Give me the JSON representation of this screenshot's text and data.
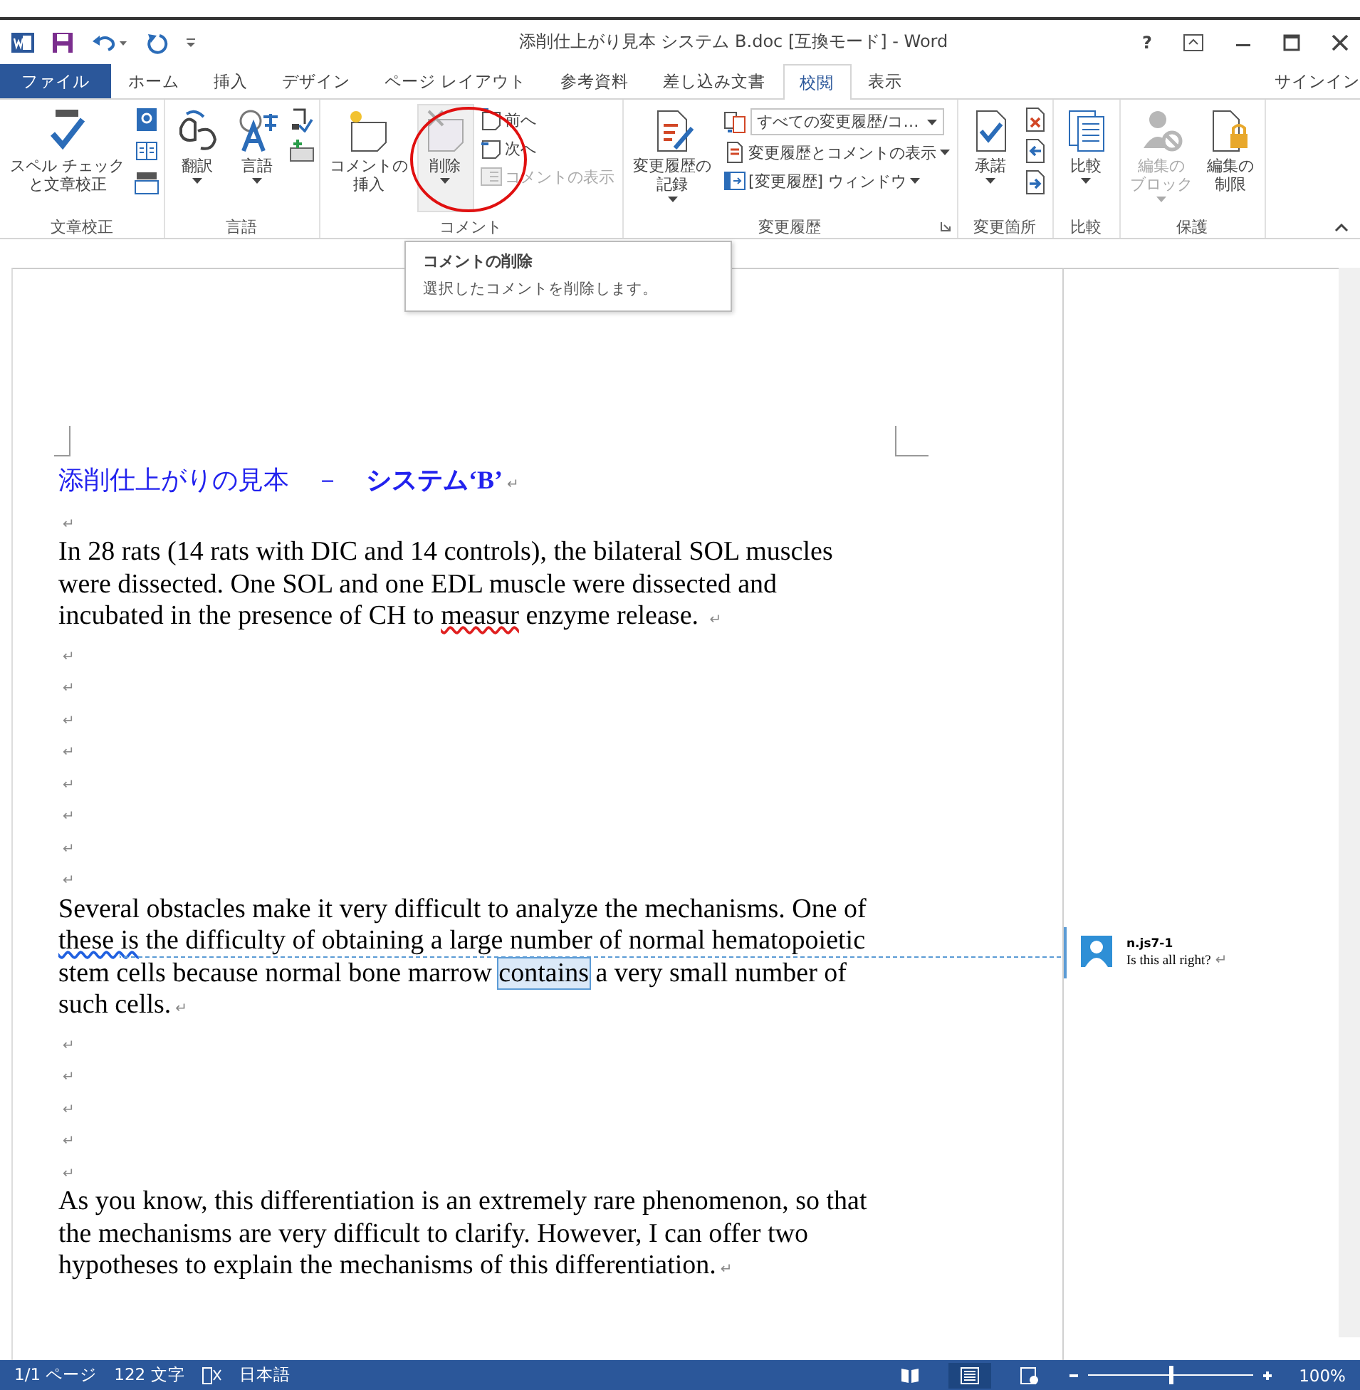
{
  "window": {
    "title": "添削仕上がり見本 システム B.doc [互換モード] - Word",
    "controls": [
      "?"
    ]
  },
  "tabs": [
    {
      "label": "ファイル",
      "kind": "file",
      "selected": false
    },
    {
      "label": "ホーム",
      "kind": "tab",
      "selected": false
    },
    {
      "label": "挿入",
      "kind": "tab",
      "selected": false
    },
    {
      "label": "デザイン",
      "kind": "tab",
      "selected": false
    },
    {
      "label": "ページ レイアウト",
      "kind": "tab",
      "selected": false
    },
    {
      "label": "参考資料",
      "kind": "tab",
      "selected": false
    },
    {
      "label": "差し込み文書",
      "kind": "tab",
      "selected": false
    },
    {
      "label": "校閲",
      "kind": "tab",
      "selected": true
    },
    {
      "label": "表示",
      "kind": "tab",
      "selected": false
    }
  ],
  "sign_in": "サインイン",
  "ribbon": [
    {
      "label": "文章校正",
      "items": [
        {
          "kind": "large",
          "label": "スペル チェックと文章校正",
          "dropdown": false,
          "disabled": false
        },
        {
          "kind": "icons"
        }
      ]
    },
    {
      "label": "言語",
      "items": [
        {
          "kind": "large",
          "label": "翻訳",
          "dropdown": true,
          "disabled": false
        },
        {
          "kind": "large",
          "label": "言語",
          "dropdown": true,
          "disabled": false
        },
        {
          "kind": "icons"
        }
      ]
    },
    {
      "label": "コメント",
      "items": [
        {
          "kind": "large",
          "label": "コメントの挿入",
          "dropdown": false,
          "disabled": false
        },
        {
          "kind": "large",
          "label": "削除",
          "dropdown": true,
          "disabled": false,
          "hovered": true
        },
        {
          "kind": "small",
          "entries": [
            {
              "label": "前へ",
              "dropdown": false,
              "disabled": false
            },
            {
              "label": "次へ",
              "dropdown": false,
              "disabled": false
            },
            {
              "label": "コメントの表示",
              "dropdown": false,
              "disabled": true
            }
          ]
        }
      ]
    },
    {
      "label": "変更履歴",
      "launcher": true,
      "items": [
        {
          "kind": "large",
          "label": "変更履歴の記録",
          "dropdown": true,
          "disabled": false
        },
        {
          "kind": "small",
          "entries": [
            {
              "label": "すべての変更履歴/コ…",
              "combo": true,
              "dropdown": true,
              "disabled": false
            },
            {
              "label": "変更履歴とコメントの表示",
              "dropdown": true,
              "disabled": false
            },
            {
              "label": "[変更履歴] ウィンドウ",
              "dropdown": true,
              "disabled": false
            }
          ]
        }
      ]
    },
    {
      "label": "変更箇所",
      "items": [
        {
          "kind": "large",
          "label": "承諾",
          "dropdown": true,
          "disabled": false
        },
        {
          "kind": "icons"
        }
      ]
    },
    {
      "label": "比較",
      "items": [
        {
          "kind": "large",
          "label": "比較",
          "dropdown": true,
          "disabled": false
        }
      ]
    },
    {
      "label": "保護",
      "items": [
        {
          "kind": "large",
          "label": "編集のブロック",
          "dropdown": true,
          "disabled": true
        },
        {
          "kind": "large",
          "label": "編集の制限",
          "dropdown": false,
          "disabled": false
        }
      ]
    }
  ],
  "tooltip": {
    "title": "コメントの削除",
    "text": "選択したコメントを削除します。"
  },
  "document": {
    "paragraphs": [
      {
        "kind": "title",
        "segments": [
          {
            "text": "添削仕上がりの見本　－　**システム‘B’**",
            "kind": "plain"
          }
        ],
        "mark": "↵"
      },
      {
        "kind": "body",
        "mark": "↵"
      },
      {
        "kind": "body",
        "segments": [
          {
            "text": "In 28 rats (14 rats with DIC and 14 controls), the bilateral SOL muscles were dissected. One SOL and one EDL muscle were dissected and incubated in the presence of CH to ",
            "kind": "plain"
          },
          {
            "text": "measur",
            "kind": "spelling"
          },
          {
            "text": " enzyme release. ",
            "kind": "plain"
          }
        ],
        "mark": "↵"
      },
      {
        "kind": "body",
        "mark": "↵"
      },
      {
        "kind": "body",
        "mark": "↵"
      },
      {
        "kind": "body",
        "mark": "↵"
      },
      {
        "kind": "body",
        "mark": "↵"
      },
      {
        "kind": "body",
        "mark": "↵"
      },
      {
        "kind": "body",
        "mark": "↵"
      },
      {
        "kind": "body",
        "mark": "↵"
      },
      {
        "kind": "body",
        "mark": "↵"
      },
      {
        "kind": "body",
        "segments": [
          {
            "text": "Several obstacles make it very difficult to analyze the mechanisms. One of ",
            "kind": "plain"
          },
          {
            "text": "these  is",
            "kind": "grammar"
          },
          {
            "text": " the difficulty of obtaining a large number of normal hematopoietic stem cells because normal bone marrow ",
            "kind": "plain"
          },
          {
            "text": "contains",
            "kind": "commented"
          },
          {
            "text": " a very small number of such cells.",
            "kind": "plain"
          }
        ],
        "mark": "↵"
      },
      {
        "kind": "body",
        "mark": "↵"
      },
      {
        "kind": "body",
        "mark": "↵"
      },
      {
        "kind": "body",
        "mark": "↵"
      },
      {
        "kind": "body",
        "mark": "↵"
      },
      {
        "kind": "body",
        "mark": "↵"
      },
      {
        "kind": "body",
        "segments": [
          {
            "text": "As you know, this differentiation is an extremely rare phenomenon, so that the mechanisms are very difficult to clarify. However, I can offer two hypotheses to explain the mechanisms of this differentiation.",
            "kind": "plain"
          }
        ],
        "mark": "↵"
      }
    ]
  },
  "comment": {
    "author": "n.js7-1",
    "text": "Is this all right?",
    "mark": "↵"
  },
  "status_bar": {
    "items": [
      "1/1 ページ",
      "122 文字",
      "日本語"
    ],
    "views": [
      {
        "kind": "read",
        "selected": false
      },
      {
        "kind": "print",
        "selected": true
      },
      {
        "kind": "web",
        "selected": false
      }
    ],
    "zoom": {
      "level": 0.5,
      "reading": "100%"
    }
  }
}
